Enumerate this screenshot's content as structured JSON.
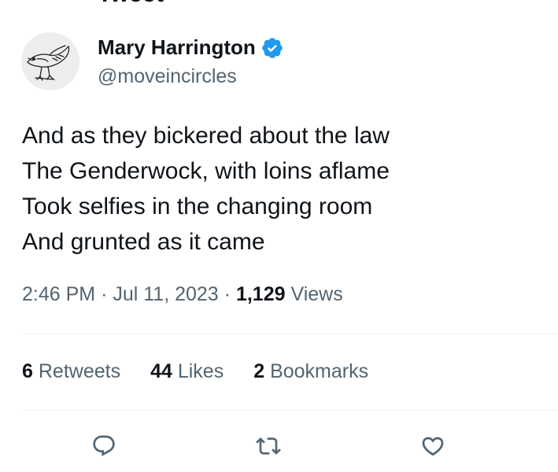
{
  "header": {
    "title": "Tweet"
  },
  "author": {
    "name": "Mary Harrington",
    "handle": "@moveincircles",
    "verified": true,
    "verified_color": "#1d9bf0"
  },
  "tweet": {
    "lines": [
      "And as they bickered about the law",
      "The Genderwock, with loins aflame",
      "Took selfies in the changing room",
      "And grunted as it came"
    ],
    "time": "2:46 PM",
    "separator": "·",
    "date": "Jul 11, 2023",
    "views_count": "1,129",
    "views_label": "Views"
  },
  "stats": {
    "retweets": {
      "count": "6",
      "label": "Retweets"
    },
    "likes": {
      "count": "44",
      "label": "Likes"
    },
    "bookmarks": {
      "count": "2",
      "label": "Bookmarks"
    }
  },
  "actions": [
    {
      "icon": "reply-icon"
    },
    {
      "icon": "retweet-icon"
    },
    {
      "icon": "like-icon"
    }
  ],
  "colors": {
    "text": "#0f1419",
    "secondary": "#536471",
    "divider": "#eff3f4",
    "icon": "#536471"
  }
}
